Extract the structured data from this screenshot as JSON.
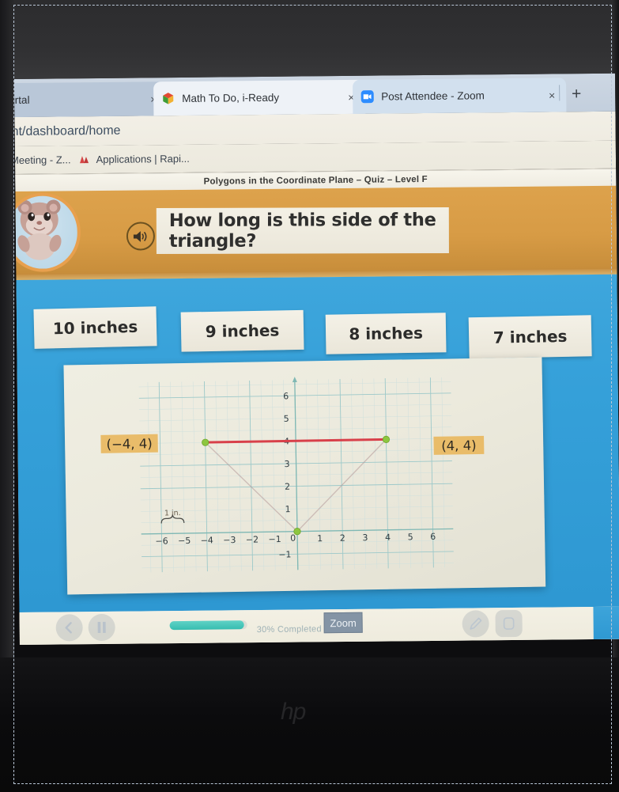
{
  "browser": {
    "tabs": [
      {
        "title": "Portal",
        "favicon": "none-icon",
        "close_label": "×"
      },
      {
        "title": "Math To Do, i-Ready",
        "favicon": "iready-cube-icon",
        "close_label": "×"
      },
      {
        "title": "Post Attendee - Zoom",
        "favicon": "zoom-camera-icon",
        "close_label": "×"
      }
    ],
    "new_tab_label": "+",
    "url": "nt/dashboard/home",
    "bookmarks": [
      {
        "label": "Meeting - Z...",
        "icon": "none-icon"
      },
      {
        "label": "Applications | Rapi...",
        "icon": "rapid-identity-icon"
      }
    ]
  },
  "lesson": {
    "title": "Polygons in the Coordinate Plane – Quiz – Level F",
    "question": "How long is this side of the triangle?",
    "avatar_name": "hamster-avatar",
    "speaker_icon": "audio-speaker-icon",
    "choices": [
      {
        "label": "10 inches"
      },
      {
        "label": "9 inches"
      },
      {
        "label": "8 inches"
      },
      {
        "label": "7 inches"
      }
    ]
  },
  "controls": {
    "back_label": "back-arrow",
    "pause_label": "pause",
    "pencil_label": "pencil",
    "eraser_label": "eraser",
    "progress_text": "30% Completed",
    "progress_percent": 96,
    "zoom_popup_label": "Zoom"
  },
  "shelf": {
    "items": [
      {
        "name": "chrome-icon"
      },
      {
        "name": "docs-icon"
      },
      {
        "name": "cursor-app-icon"
      }
    ]
  },
  "device": {
    "brand": "hp"
  },
  "colors": {
    "banner_orange": "#d79b45",
    "answer_blue": "#35a0d9",
    "segment_red": "#d8404a",
    "point_green": "#8dc63f",
    "label_tan": "#e8b760",
    "grid_teal": "#9ec9c9"
  },
  "chart_data": {
    "type": "scatter",
    "title": "",
    "xlabel": "",
    "ylabel": "",
    "xlim": [
      -6.8,
      6.8
    ],
    "ylim": [
      -1.6,
      6.6
    ],
    "xticks": [
      "−6",
      "−5",
      "−4",
      "−3",
      "−2",
      "−1",
      "0",
      "1",
      "2",
      "3",
      "4",
      "5",
      "6"
    ],
    "yticks": [
      "6",
      "5",
      "4",
      "3",
      "2",
      "1",
      "0",
      "−1"
    ],
    "grid": true,
    "grid_minor": true,
    "scale_note": "1 in.",
    "scale_span": [
      -6,
      -5
    ],
    "points": [
      {
        "x": -4,
        "y": 4,
        "label": "(−4, 4)",
        "label_side": "left"
      },
      {
        "x": 4,
        "y": 4,
        "label": "(4, 4)",
        "label_side": "right"
      },
      {
        "x": 0,
        "y": 0,
        "label": "",
        "label_side": "none"
      }
    ],
    "segments": [
      {
        "from": [
          -4,
          4
        ],
        "to": [
          4,
          4
        ],
        "color": "#d8404a",
        "width": 3,
        "highlight": true
      },
      {
        "from": [
          -4,
          4
        ],
        "to": [
          0,
          0
        ],
        "color": "#b59a9a",
        "width": 1.4,
        "highlight": false
      },
      {
        "from": [
          0,
          0
        ],
        "to": [
          4,
          4
        ],
        "color": "#b59a9a",
        "width": 1.4,
        "highlight": false
      }
    ],
    "annotation": "Highlighted top side of triangle from (−4, 4) to (4, 4); length 8 units = 8 inches"
  }
}
